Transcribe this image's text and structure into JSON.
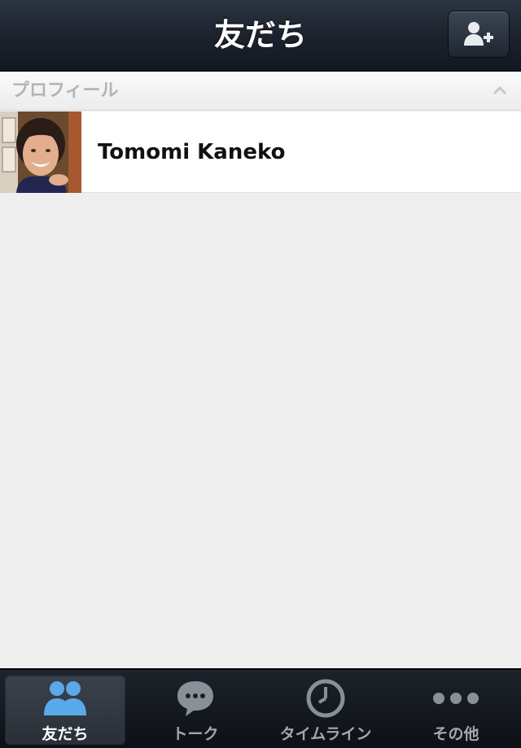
{
  "navbar": {
    "title": "友だち",
    "add_friend_icon": "add-person-icon"
  },
  "section": {
    "title": "プロフィール",
    "collapse_icon": "chevron-up-icon"
  },
  "profile": {
    "name": "Tomomi Kaneko"
  },
  "tabbar": {
    "tabs": [
      {
        "label": "友だち",
        "icon": "friends-icon",
        "active": true
      },
      {
        "label": "トーク",
        "icon": "chat-bubble-icon",
        "active": false
      },
      {
        "label": "タイムライン",
        "icon": "clock-icon",
        "active": false
      },
      {
        "label": "その他",
        "icon": "more-dots-icon",
        "active": false
      }
    ]
  },
  "colors": {
    "navbar_bg": "#1c232e",
    "tab_active_icon": "#5aa9ea",
    "tab_inactive_icon": "#8a9097"
  }
}
